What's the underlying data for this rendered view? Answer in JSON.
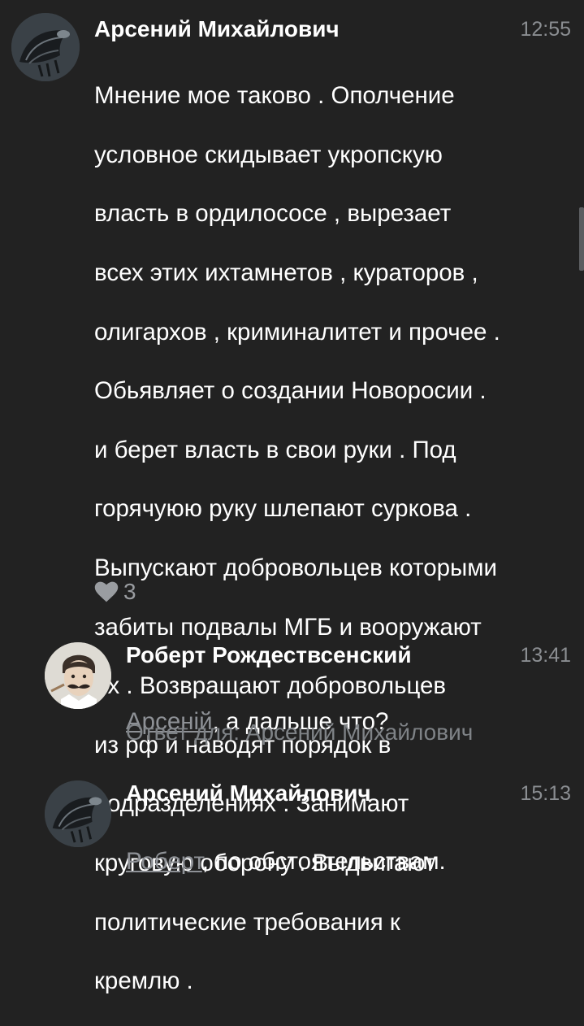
{
  "comments": [
    {
      "author": "Арсений Михайлович",
      "time": "12:55",
      "avatar_icon": "alien-avatar",
      "lines": [
        "Мнение мое таково . Ополчение",
        "условное скидывает укропскую",
        "власть в ордилососе , вырезает",
        "всех этих ихтамнетов , кураторов ,",
        "олигархов , криминалитет и прочее .",
        "Обьявляет о создании Новоросии .",
        "и берет власть в свои руки . Под",
        "горячуюю руку шлепают суркова .",
        "Выпускают добровольцев которыми",
        "забиты подвалы МГБ и вооружают",
        "их . Возвращают добровольцев",
        "из рф и наводят порядок в",
        "подразделениях . Занимают",
        "круговую оборону . Выдвигают",
        "политические требования к",
        "кремлю ."
      ],
      "likes": "3"
    },
    {
      "author": "Роберт Рождествсенский",
      "time": "13:41",
      "avatar_icon": "mustache-man-avatar",
      "mention": "Арсеній",
      "text": ", а дальше что?",
      "reply_to": "Ответ для: Арсений Михайлович"
    },
    {
      "author": "Арсений Михайлович",
      "time": "15:13",
      "avatar_icon": "alien-avatar",
      "mention": "Роберт",
      "text": ", по обстоятельствам."
    }
  ],
  "colors": {
    "background": "#222222",
    "author": "#ffffff",
    "meta": "#8b8e92",
    "mention": "#8e9196"
  }
}
